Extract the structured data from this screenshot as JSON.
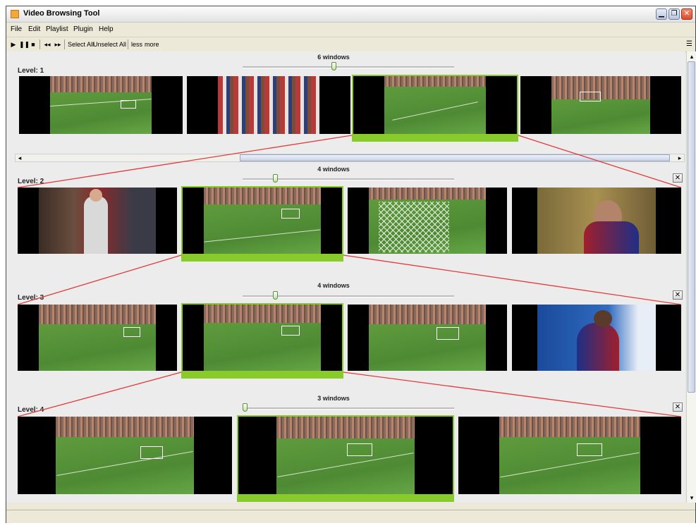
{
  "window": {
    "title": "Video Browsing Tool"
  },
  "menu": [
    "File",
    "Edit",
    "Playlist",
    "Plugin",
    "Help"
  ],
  "toolbar": {
    "play_icon": "play-icon",
    "pause_icon": "pause-icon",
    "stop_icon": "stop-icon",
    "rewind_icon": "rewind-icon",
    "forward_icon": "fast-forward-icon",
    "select_all": "Select All",
    "unselect_all": "Unselect All",
    "less": "less",
    "more": "more"
  },
  "levels": [
    {
      "label": "Level: 1",
      "windows_label": "6 windows",
      "selected_index": 2,
      "thumbnails": 4
    },
    {
      "label": "Level: 2",
      "windows_label": "4 windows",
      "selected_index": 1,
      "thumbnails": 4
    },
    {
      "label": "Level: 3",
      "windows_label": "4 windows",
      "selected_index": 1,
      "thumbnails": 4
    },
    {
      "label": "Level: 4",
      "windows_label": "3 windows",
      "selected_index": 1,
      "thumbnails": 3
    }
  ],
  "colors": {
    "selection": "#8acb2c",
    "connector": "#e23b3b",
    "pitch": "#5f9b3d"
  }
}
